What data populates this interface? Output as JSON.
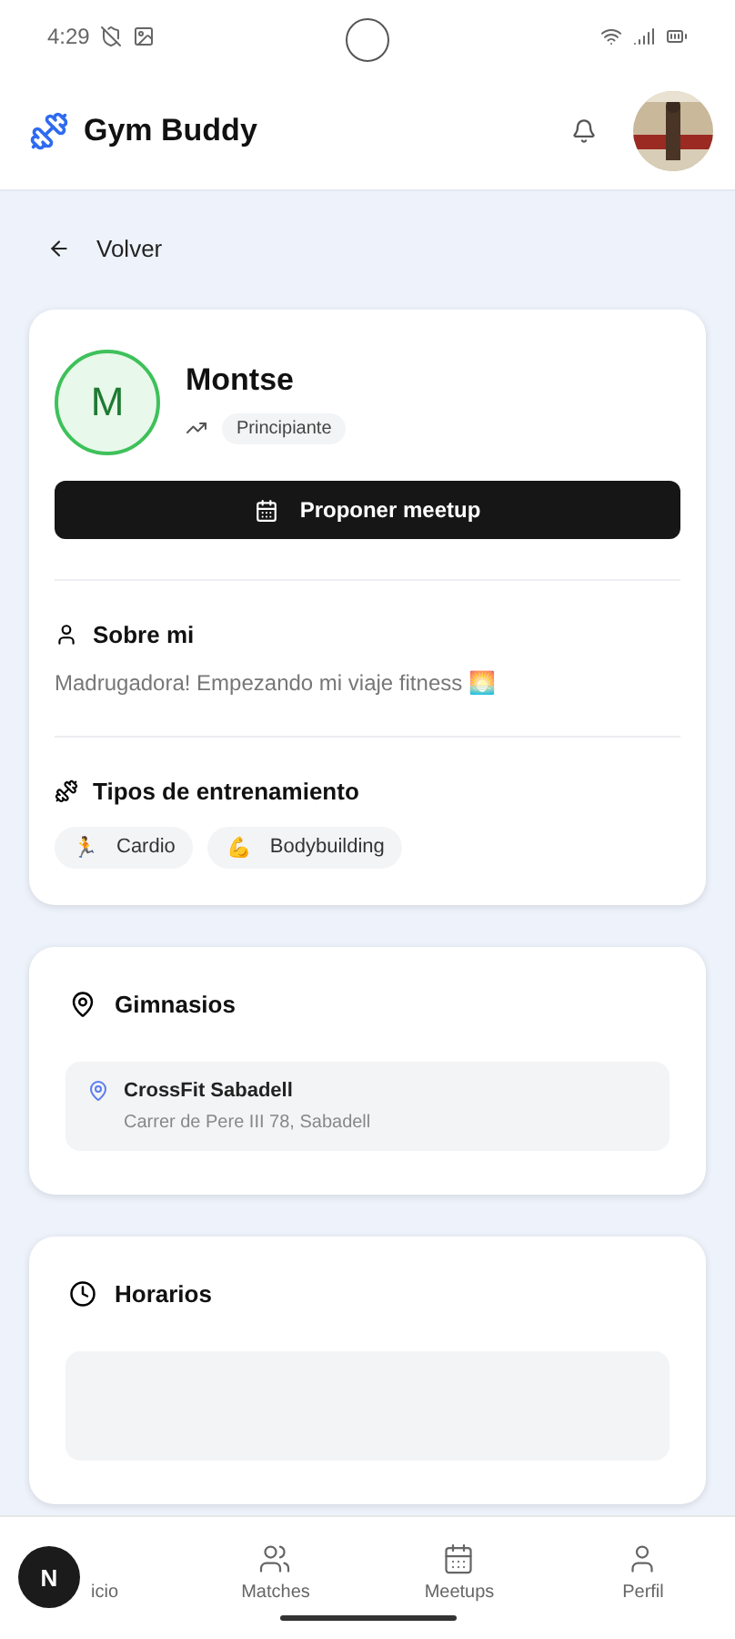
{
  "status_bar": {
    "time": "4:29"
  },
  "header": {
    "title": "Gym Buddy"
  },
  "back": {
    "label": "Volver"
  },
  "profile": {
    "initial": "M",
    "name": "Montse",
    "level": "Principiante",
    "button": "Proponer meetup",
    "about": {
      "title": "Sobre mi",
      "text": "Madrugadora! Empezando mi viaje fitness 🌅"
    },
    "training": {
      "title": "Tipos de entrenamiento",
      "tags": [
        {
          "emoji": "🏃",
          "label": "Cardio"
        },
        {
          "emoji": "💪",
          "label": "Bodybuilding"
        }
      ]
    }
  },
  "gyms": {
    "title": "Gimnasios",
    "items": [
      {
        "name": "CrossFit Sabadell",
        "address": "Carrer de Pere III 78, Sabadell"
      }
    ]
  },
  "schedule": {
    "title": "Horarios"
  },
  "nav": [
    {
      "label": "icio",
      "selected": false
    },
    {
      "label": "Matches",
      "selected": false
    },
    {
      "label": "Meetups",
      "selected": false
    },
    {
      "label": "Perfil",
      "selected": false
    }
  ],
  "dev_badge": {
    "letter": "N"
  }
}
